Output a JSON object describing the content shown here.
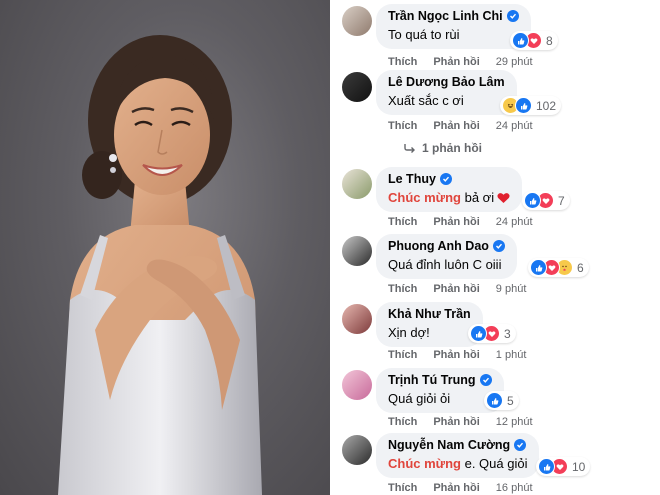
{
  "comments": [
    {
      "name": "Trần Ngọc Linh Chi",
      "verified": true,
      "text": "To quá to rùi",
      "reaction_count": "8",
      "reactions": [
        "like",
        "heart"
      ],
      "like_label": "Thích",
      "reply_label": "Phản hồi",
      "time": "29 phút"
    },
    {
      "name": "Lê Dương Bảo Lâm",
      "verified": false,
      "text": "Xuất sắc c ơi",
      "reaction_count": "102",
      "reactions": [
        "haha",
        "like"
      ],
      "like_label": "Thích",
      "reply_label": "Phản hồi",
      "time": "24 phút",
      "replies_label": "1 phản hồi"
    },
    {
      "name": "Le Thuy",
      "verified": true,
      "mention": "Chúc mừng",
      "text": "bả ơi",
      "reaction_count": "7",
      "reactions": [
        "like",
        "heart"
      ],
      "like_label": "Thích",
      "reply_label": "Phản hồi",
      "time": "24 phút"
    },
    {
      "name": "Phuong Anh Dao",
      "verified": true,
      "text": "Quá đỉnh luôn C oiii",
      "reaction_count": "6",
      "reactions": [
        "like",
        "heart",
        "haha"
      ],
      "like_label": "Thích",
      "reply_label": "Phản hồi",
      "time": "9 phút"
    },
    {
      "name": "Khả Như Trần",
      "verified": false,
      "text": "Xịn dợ!",
      "reaction_count": "3",
      "reactions": [
        "like",
        "heart"
      ],
      "like_label": "Thích",
      "reply_label": "Phản hồi",
      "time": "1 phút"
    },
    {
      "name": "Trịnh Tú Trung",
      "verified": true,
      "text": "Quá giỏi ỏi",
      "reaction_count": "5",
      "reactions": [
        "like"
      ],
      "like_label": "Thích",
      "reply_label": "Phản hồi",
      "time": "12 phút"
    },
    {
      "name": "Nguyễn Nam Cường",
      "verified": true,
      "mention": "Chúc mừng",
      "text": "e. Quá giỏi",
      "reaction_count": "10",
      "reactions": [
        "like",
        "heart"
      ],
      "like_label": "Thích",
      "reply_label": "Phản hồi",
      "time": "16 phút"
    }
  ],
  "colors": {
    "bubble": "#f0f2f5",
    "mention": "#e0453c",
    "like": "#1877f2",
    "heart": "#f33e58",
    "meta": "#65676b"
  }
}
